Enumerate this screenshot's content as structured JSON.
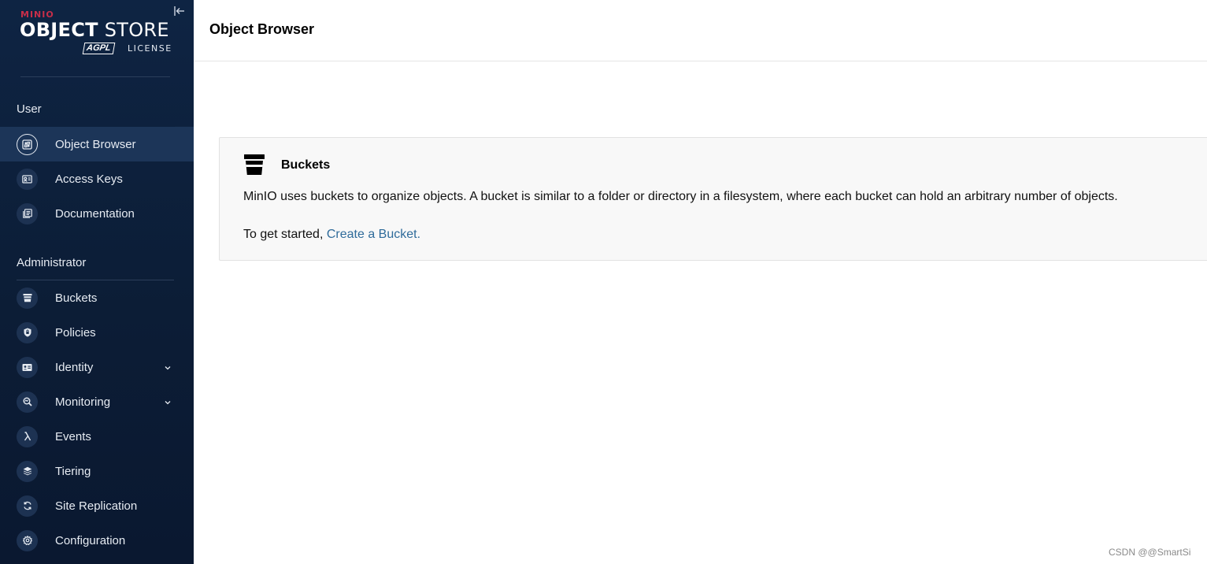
{
  "sidebar": {
    "logo": {
      "minio": "MINIO",
      "title_bold": "OBJECT",
      "title_rest": " STORE",
      "agpl": "AGPL",
      "license": "LICENSE"
    },
    "sections": {
      "user": "User",
      "administrator": "Administrator"
    },
    "user_items": [
      {
        "label": "Object Browser",
        "icon": "object-browser-icon"
      },
      {
        "label": "Access Keys",
        "icon": "access-keys-icon"
      },
      {
        "label": "Documentation",
        "icon": "documentation-icon"
      }
    ],
    "admin_items": [
      {
        "label": "Buckets",
        "icon": "bucket-icon"
      },
      {
        "label": "Policies",
        "icon": "policy-icon"
      },
      {
        "label": "Identity",
        "icon": "identity-icon"
      },
      {
        "label": "Monitoring",
        "icon": "monitoring-icon"
      },
      {
        "label": "Events",
        "icon": "lambda-icon"
      },
      {
        "label": "Tiering",
        "icon": "tiering-icon"
      },
      {
        "label": "Site Replication",
        "icon": "site-replication-icon"
      },
      {
        "label": "Configuration",
        "icon": "gear-icon"
      }
    ]
  },
  "header": {
    "title": "Object Browser"
  },
  "panel": {
    "title": "Buckets",
    "description": "MinIO uses buckets to organize objects. A bucket is similar to a folder or directory in a filesystem, where each bucket can hold an arbitrary number of objects.",
    "start_prefix": "To get started, ",
    "start_link": "Create a Bucket."
  },
  "watermark": "CSDN @@SmartSi",
  "colors": {
    "sidebar_bg": "#0e2443",
    "active_bg": "#1c3558",
    "link": "#2f6b9a"
  }
}
